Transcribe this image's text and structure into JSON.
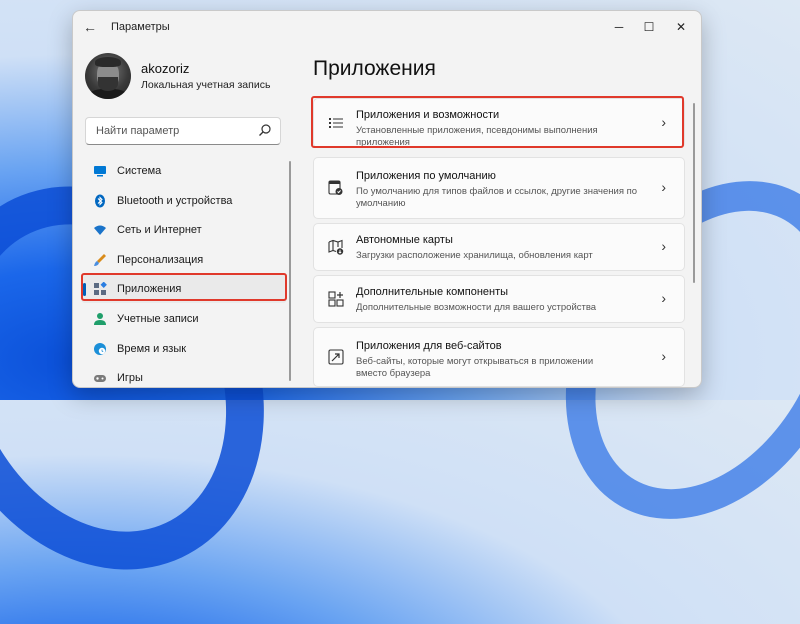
{
  "window": {
    "title": "Параметры",
    "minimize": "─",
    "maximize": "☐",
    "close": "✕",
    "back": "←"
  },
  "user": {
    "name": "akozoriz",
    "account_type": "Локальная учетная запись"
  },
  "search": {
    "placeholder": "Найти параметр"
  },
  "sidebar": {
    "items": [
      {
        "label": "Система",
        "icon": "monitor-icon",
        "color": "#0078d4"
      },
      {
        "label": "Bluetooth и устройства",
        "icon": "bluetooth-icon",
        "color": "#0067c0"
      },
      {
        "label": "Сеть и Интернет",
        "icon": "wifi-icon",
        "color": "#1a73c9"
      },
      {
        "label": "Персонализация",
        "icon": "brush-icon",
        "color": "#d98b1a"
      },
      {
        "label": "Приложения",
        "icon": "apps-icon",
        "color": "#5b6b82",
        "active": true
      },
      {
        "label": "Учетные записи",
        "icon": "person-icon",
        "color": "#1f9e6a"
      },
      {
        "label": "Время и язык",
        "icon": "globe-clock-icon",
        "color": "#1b8fd8"
      },
      {
        "label": "Игры",
        "icon": "gamepad-icon",
        "color": "#7a7a7a"
      }
    ]
  },
  "main": {
    "title": "Приложения",
    "cards": [
      {
        "title": "Приложения и возможности",
        "desc": "Установленные приложения, псевдонимы выполнения приложения",
        "icon": "list-icon"
      },
      {
        "title": "Приложения по умолчанию",
        "desc": "По умолчанию для типов файлов и ссылок, другие значения по умолчанию",
        "icon": "default-app-icon"
      },
      {
        "title": "Автономные карты",
        "desc": "Загрузки расположение хранилища, обновления карт",
        "icon": "map-download-icon"
      },
      {
        "title": "Дополнительные компоненты",
        "desc": "Дополнительные возможности для вашего устройства",
        "icon": "add-components-icon"
      },
      {
        "title": "Приложения для веб-сайтов",
        "desc": "Веб-сайты, которые могут открываться в приложении вместо браузера",
        "icon": "web-app-icon"
      }
    ],
    "chevron": "›"
  },
  "colors": {
    "accent": "#005fb8",
    "highlight": "#e0392b"
  }
}
